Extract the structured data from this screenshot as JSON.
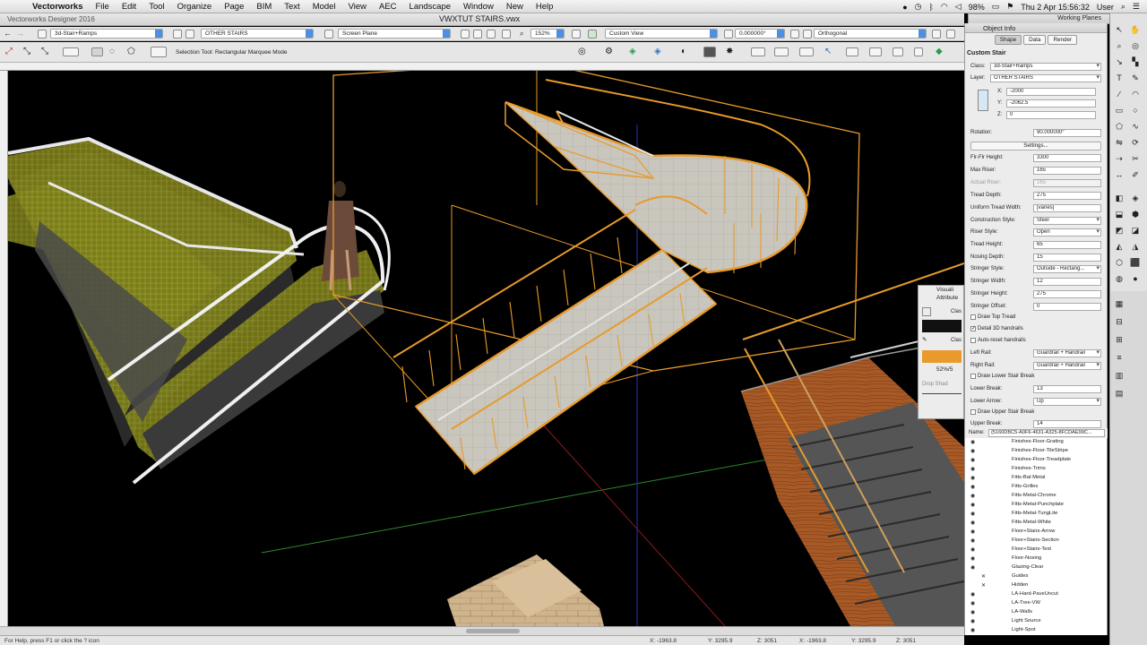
{
  "menubar": {
    "app": "Vectorworks",
    "items": [
      "File",
      "Edit",
      "Tool",
      "Organize",
      "Page",
      "BIM",
      "Text",
      "Model",
      "View",
      "AEC",
      "Landscape",
      "Window",
      "New",
      "Help"
    ],
    "battery": "98%",
    "clock": "Thu 2 Apr  15:56:32",
    "user": "User"
  },
  "titlebar": {
    "app_title": "Vectorworks Designer 2016",
    "document": "VWXTUT STAIRS.vwx"
  },
  "view_bar": {
    "class": "3d-Stair+Ramps",
    "layer": "OTHER STAIRS",
    "plane": "Screen Plane",
    "zoom": "152%",
    "view": "Custom View",
    "rotation": "0.000000°",
    "projection": "Orthogonal"
  },
  "mode_bar": {
    "hint": "Selection Tool: Rectangular Marquee Mode"
  },
  "working_planes": {
    "title": "Working Planes"
  },
  "object_info": {
    "title": "Object Info",
    "tabs": [
      "Shape",
      "Data",
      "Render"
    ],
    "heading": "Custom Stair",
    "class_label": "Class:",
    "class_value": "3d-Stair+Ramps",
    "layer_label": "Layer:",
    "layer_value": "OTHER STAIRS",
    "x_label": "X:",
    "x_value": "-2000",
    "y_label": "Y:",
    "y_value": "-2062.5",
    "z_label": "Z:",
    "z_value": "0",
    "rotation_label": "Rotation:",
    "rotation_value": "90.000000°",
    "settings_button": "Settings...",
    "fields": [
      {
        "label": "Flr-Flr Height:",
        "value": "3300"
      },
      {
        "label": "Max Riser:",
        "value": "165"
      },
      {
        "label": "Actual Riser:",
        "value": "165"
      },
      {
        "label": "Tread Depth:",
        "value": "275"
      },
      {
        "label": "Uniform Tread Width:",
        "value": "[varies]"
      },
      {
        "label": "Construction Style:",
        "value": "Steel"
      },
      {
        "label": "Riser Style:",
        "value": "Open"
      },
      {
        "label": "Tread Height:",
        "value": "65"
      },
      {
        "label": "Nosing Depth:",
        "value": "15"
      },
      {
        "label": "Stringer Style:",
        "value": "Outside - Rectang..."
      },
      {
        "label": "Stringer Width:",
        "value": "12"
      },
      {
        "label": "Stringer Height:",
        "value": "275"
      },
      {
        "label": "Stringer Offset:",
        "value": "0"
      }
    ],
    "checks": [
      {
        "label": "Draw Top Tread",
        "checked": ""
      },
      {
        "label": "Detail 3D handrails",
        "checked": "✓"
      },
      {
        "label": "Auto-reset handrails",
        "checked": ""
      }
    ],
    "left_rail_label": "Left Rail:",
    "left_rail_value": "Guardrail + Handrail",
    "right_rail_label": "Right Rail:",
    "right_rail_value": "Guardrail + Handrail",
    "draw_lower_break": "Draw Lower Stair Break",
    "lower_break_label": "Lower Break:",
    "lower_break_value": "13",
    "lower_arrow_label": "Lower Arrow:",
    "lower_arrow_value": "Up",
    "draw_upper_break": "Draw Upper Stair Break",
    "upper_break_label": "Upper Break:",
    "upper_break_value": "14",
    "name_label": "Name:",
    "name_value": "{5160DBC5-A0F6-4631-A325-8FCDAE99C..."
  },
  "attributes": {
    "visualization": "Visuali",
    "attributes": "Attribute",
    "class1": "Clas",
    "class2": "Clas",
    "percent": "52%/5",
    "drop_shadow": "Drop Shad"
  },
  "class_list": [
    "Finishes-Floor-Grating",
    "Finishes-Floor-TileStripe",
    "Finishes-Floor-Treadplate",
    "Finishes-Trims",
    "Fitts-Bal-Metal",
    "Fitts-Grilles",
    "Fitts-Metal-Chrome",
    "Fitts-Metal-Punchplate",
    "Fitts-Metal-TungLite",
    "Fitts-Metal-White",
    "Floor+Stairs-Arrow",
    "Floor+Stairs-Section",
    "Floor+Stairs-Text",
    "Floor-Nosing",
    "Glazing-Clear",
    "Guides",
    "Hidden",
    "LA-Hard-PaveUncut",
    "LA-Tree-VW",
    "LA-Walls",
    "Light Source",
    "Light-Spot"
  ],
  "status": {
    "help": "For Help, press F1 or click the ? icon",
    "x1": "X: -1963.8",
    "y1": "Y: 3295.9",
    "z1": "Z: 3051",
    "x2": "X: -1963.8",
    "y2": "Y: 3295.9",
    "z2": "Z: 3051"
  },
  "colors": {
    "wireframe": "#e89a2c",
    "glass": "#8a8d1e",
    "wood": "#b0602a",
    "tile": "#c9c6bd",
    "accent": "#4d8fe0"
  },
  "icons": [
    "apple-icon",
    "wifi-icon",
    "battery-icon",
    "search-icon",
    "selection-arrow-icon",
    "text-tool-icon",
    "eye-icon"
  ]
}
